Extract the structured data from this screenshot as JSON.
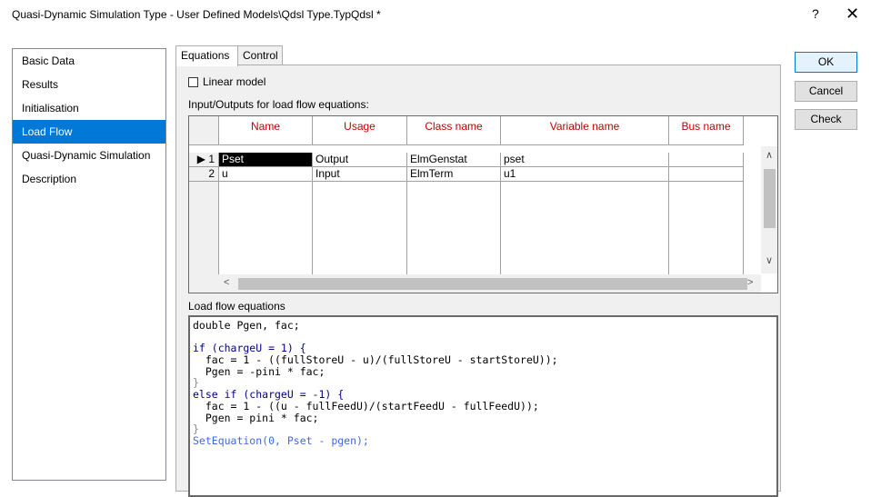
{
  "window": {
    "title": "Quasi-Dynamic Simulation Type - User Defined Models\\Qdsl Type.TypQdsl *",
    "help_label": "?",
    "close_label": "✕"
  },
  "sidebar": {
    "items": [
      {
        "label": "Basic Data"
      },
      {
        "label": "Results"
      },
      {
        "label": "Initialisation"
      },
      {
        "label": "Load Flow"
      },
      {
        "label": "Quasi-Dynamic Simulation"
      },
      {
        "label": "Description"
      }
    ],
    "selected": "Load Flow"
  },
  "tabs": [
    {
      "label": "Equations",
      "active": true
    },
    {
      "label": "Control",
      "active": false
    }
  ],
  "linear_model": {
    "label": "Linear model",
    "checked": false
  },
  "io_table": {
    "label": "Input/Outputs for load flow equations:",
    "columns": [
      "Name",
      "Usage",
      "Class name",
      "Variable name",
      "Bus name"
    ],
    "rows": [
      {
        "index": "1",
        "marker": "▶",
        "name": "Pset",
        "usage": "Output",
        "class_name": "ElmGenstat",
        "variable_name": "pset",
        "bus_name": ""
      },
      {
        "index": "2",
        "marker": "",
        "name": "u",
        "usage": "Input",
        "class_name": "ElmTerm",
        "variable_name": "u1",
        "bus_name": ""
      }
    ]
  },
  "equations": {
    "label": "Load flow equations",
    "lines": [
      "double Pgen, fac;",
      "",
      "if (chargeU = 1) {",
      "  fac = 1 - ((fullStoreU - u)/(fullStoreU - startStoreU));",
      "  Pgen = -pini * fac;",
      "}",
      "else if (chargeU = -1) {",
      "  fac = 1 - ((u - fullFeedU)/(startFeedU - fullFeedU));",
      "  Pgen = pini * fac;",
      "}",
      "SetEquation(0, Pset - pgen);"
    ]
  },
  "buttons": {
    "ok": "OK",
    "cancel": "Cancel",
    "check": "Check"
  },
  "colors": {
    "selection": "#0078d7",
    "header_text": "#c00000",
    "keyword": "#00008b"
  }
}
